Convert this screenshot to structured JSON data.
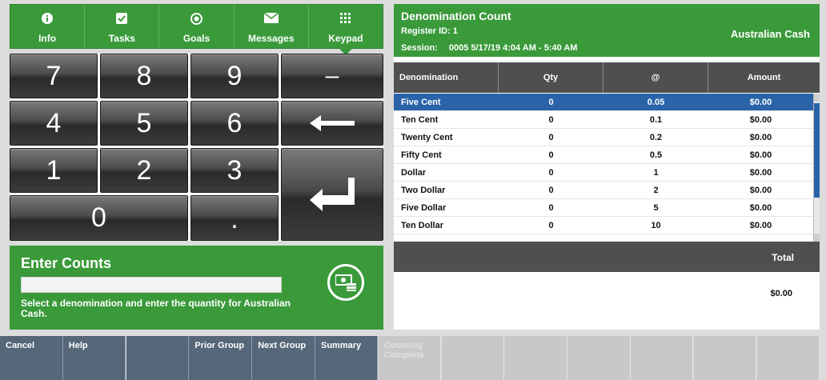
{
  "nav": {
    "tabs": [
      {
        "label": "Info",
        "icon": "info-icon"
      },
      {
        "label": "Tasks",
        "icon": "checkbox-icon"
      },
      {
        "label": "Goals",
        "icon": "target-icon"
      },
      {
        "label": "Messages",
        "icon": "envelope-icon"
      },
      {
        "label": "Keypad",
        "icon": "keypad-icon",
        "active": true
      }
    ]
  },
  "keypad": {
    "k7": "7",
    "k8": "8",
    "k9": "9",
    "minus": "–",
    "k4": "4",
    "k5": "5",
    "k6": "6",
    "k1": "1",
    "k2": "2",
    "k3": "3",
    "k0": "0",
    "dot": "."
  },
  "enter_counts": {
    "title": "Enter Counts",
    "value": "",
    "message": "Select a denomination and enter the quantity for Australian Cash."
  },
  "denomination_panel": {
    "title": "Denomination Count",
    "register": "Register ID: 1",
    "session_label": "Session:",
    "session_value": "0005  5/17/19 4:04 AM - 5:40 AM",
    "currency": "Australian Cash",
    "columns": [
      "Denomination",
      "Qty",
      "@",
      "Amount"
    ],
    "rows": [
      {
        "name": "Five Cent",
        "qty": "0",
        "at": "0.05",
        "amount": "$0.00",
        "selected": true
      },
      {
        "name": "Ten Cent",
        "qty": "0",
        "at": "0.1",
        "amount": "$0.00"
      },
      {
        "name": "Twenty Cent",
        "qty": "0",
        "at": "0.2",
        "amount": "$0.00"
      },
      {
        "name": "Fifty Cent",
        "qty": "0",
        "at": "0.5",
        "amount": "$0.00"
      },
      {
        "name": "Dollar",
        "qty": "0",
        "at": "1",
        "amount": "$0.00"
      },
      {
        "name": "Two Dollar",
        "qty": "0",
        "at": "2",
        "amount": "$0.00"
      },
      {
        "name": "Five Dollar",
        "qty": "0",
        "at": "5",
        "amount": "$0.00"
      },
      {
        "name": "Ten Dollar",
        "qty": "0",
        "at": "10",
        "amount": "$0.00"
      }
    ],
    "total_label": "Total",
    "total_value": "$0.00"
  },
  "function_bar": [
    {
      "label": "Cancel",
      "enabled": true
    },
    {
      "label": "Help",
      "enabled": true
    },
    {
      "label": "",
      "enabled": true
    },
    {
      "label": "Prior Group",
      "enabled": true
    },
    {
      "label": "Next Group",
      "enabled": true
    },
    {
      "label": "Summary",
      "enabled": true
    },
    {
      "label": "Counting Complete",
      "enabled": false
    },
    {
      "label": "",
      "enabled": false
    },
    {
      "label": "",
      "enabled": false
    },
    {
      "label": "",
      "enabled": false
    },
    {
      "label": "",
      "enabled": false
    },
    {
      "label": "",
      "enabled": false
    },
    {
      "label": "",
      "enabled": false
    }
  ],
  "colors": {
    "accent_green": "#3a9a3a",
    "selected_row": "#2a63a8",
    "header_gray": "#4f4f4f",
    "function_button": "#56677a"
  }
}
